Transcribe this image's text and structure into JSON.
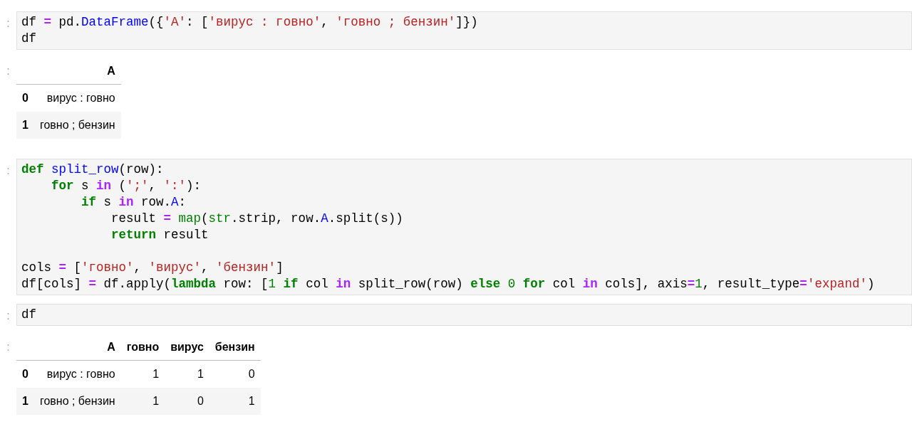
{
  "cells": [
    {
      "kind": "code",
      "prompt": ":",
      "blocks": [
        [
          [
            {
              "t": "df ",
              "kind": "plain"
            },
            {
              "t": "=",
              "kind": "op"
            },
            {
              "t": " pd.",
              "kind": "plain"
            },
            {
              "t": "DataFrame",
              "kind": "name"
            },
            {
              "t": "({",
              "kind": "plain"
            },
            {
              "t": "'A'",
              "kind": "str"
            },
            {
              "t": ": [",
              "kind": "plain"
            },
            {
              "t": "'вирус : говно'",
              "kind": "str"
            },
            {
              "t": ", ",
              "kind": "plain"
            },
            {
              "t": "'говно ; бензин'",
              "kind": "str"
            },
            {
              "t": "]})",
              "kind": "plain"
            }
          ],
          [
            {
              "t": "df",
              "kind": "plain"
            }
          ]
        ]
      ]
    },
    {
      "kind": "table",
      "prompt": ":",
      "columns": [
        "A"
      ],
      "rows": [
        {
          "index": "0",
          "cells": [
            "вирус : говно"
          ]
        },
        {
          "index": "1",
          "cells": [
            "говно ; бензин"
          ]
        }
      ]
    },
    {
      "kind": "code",
      "prompt": ":",
      "blocks": [
        [
          [
            {
              "t": "def ",
              "kind": "kw"
            },
            {
              "t": "split_row",
              "kind": "name"
            },
            {
              "t": "(row):",
              "kind": "plain"
            }
          ],
          [
            {
              "t": "    for",
              "kind": "kw"
            },
            {
              "t": " s ",
              "kind": "plain"
            },
            {
              "t": "in",
              "kind": "opkw"
            },
            {
              "t": " (",
              "kind": "plain"
            },
            {
              "t": "';'",
              "kind": "str"
            },
            {
              "t": ", ",
              "kind": "plain"
            },
            {
              "t": "':'",
              "kind": "str"
            },
            {
              "t": "):",
              "kind": "plain"
            }
          ],
          [
            {
              "t": "        if",
              "kind": "kw"
            },
            {
              "t": " s ",
              "kind": "plain"
            },
            {
              "t": "in",
              "kind": "opkw"
            },
            {
              "t": " row.",
              "kind": "plain"
            },
            {
              "t": "A",
              "kind": "name"
            },
            {
              "t": ":",
              "kind": "plain"
            }
          ],
          [
            {
              "t": "            result ",
              "kind": "plain"
            },
            {
              "t": "=",
              "kind": "op"
            },
            {
              "t": " map",
              "kind": "builtin"
            },
            {
              "t": "(",
              "kind": "plain"
            },
            {
              "t": "str",
              "kind": "builtin"
            },
            {
              "t": ".strip, row.",
              "kind": "plain"
            },
            {
              "t": "A",
              "kind": "name"
            },
            {
              "t": ".split(s))",
              "kind": "plain"
            }
          ],
          [
            {
              "t": "            return",
              "kind": "kw"
            },
            {
              "t": " result",
              "kind": "plain"
            }
          ]
        ],
        [
          [
            {
              "t": "cols ",
              "kind": "plain"
            },
            {
              "t": "=",
              "kind": "op"
            },
            {
              "t": " [",
              "kind": "plain"
            },
            {
              "t": "'говно'",
              "kind": "str"
            },
            {
              "t": ", ",
              "kind": "plain"
            },
            {
              "t": "'вирус'",
              "kind": "str"
            },
            {
              "t": ", ",
              "kind": "plain"
            },
            {
              "t": "'бензин'",
              "kind": "str"
            },
            {
              "t": "]",
              "kind": "plain"
            }
          ],
          [
            {
              "t": "df[cols] ",
              "kind": "plain"
            },
            {
              "t": "=",
              "kind": "op"
            },
            {
              "t": " df.apply(",
              "kind": "plain"
            },
            {
              "t": "lambda",
              "kind": "kw"
            },
            {
              "t": " row: [",
              "kind": "plain"
            },
            {
              "t": "1",
              "kind": "num"
            },
            {
              "t": " if",
              "kind": "kw"
            },
            {
              "t": " col ",
              "kind": "plain"
            },
            {
              "t": "in",
              "kind": "opkw"
            },
            {
              "t": " split_row(row) ",
              "kind": "plain"
            },
            {
              "t": "else",
              "kind": "kw"
            },
            {
              "t": " 0",
              "kind": "num"
            },
            {
              "t": " for",
              "kind": "kw"
            },
            {
              "t": " col ",
              "kind": "plain"
            },
            {
              "t": "in",
              "kind": "opkw"
            },
            {
              "t": " cols], axis",
              "kind": "plain"
            },
            {
              "t": "=",
              "kind": "op"
            },
            {
              "t": "1",
              "kind": "num"
            },
            {
              "t": ", result_type",
              "kind": "plain"
            },
            {
              "t": "=",
              "kind": "op"
            },
            {
              "t": "'expand'",
              "kind": "str"
            },
            {
              "t": ")",
              "kind": "plain"
            }
          ]
        ]
      ]
    },
    {
      "kind": "code",
      "prompt": ":",
      "blocks": [
        [
          [
            {
              "t": "df",
              "kind": "plain"
            }
          ]
        ]
      ]
    },
    {
      "kind": "table",
      "prompt": ":",
      "columns": [
        "A",
        "говно",
        "вирус",
        "бензин"
      ],
      "rows": [
        {
          "index": "0",
          "cells": [
            "вирус : говно",
            "1",
            "1",
            "0"
          ]
        },
        {
          "index": "1",
          "cells": [
            "говно ; бензин",
            "1",
            "0",
            "1"
          ]
        }
      ]
    }
  ]
}
